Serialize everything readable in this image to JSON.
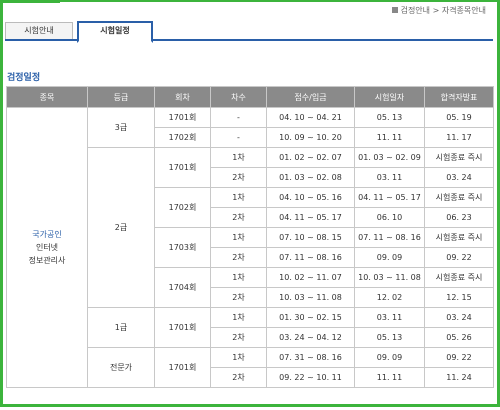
{
  "breadcrumb": [
    "검정안내",
    "자격종목안내"
  ],
  "tabs": [
    "시험안내",
    "시험일정"
  ],
  "section_title": "검정일정",
  "columns": [
    "종목",
    "등급",
    "회차",
    "차수",
    "접수/입금",
    "시험일자",
    "합격자발표"
  ],
  "kind": [
    "국가공인",
    "인터넷",
    "정보관리사"
  ],
  "rows": [
    {
      "grade": "3급",
      "session": "1701회",
      "cha": "-",
      "apply": "04. 10 ~ 04. 21",
      "exam": "05. 13",
      "result": "05. 19"
    },
    {
      "session": "1702회",
      "cha": "-",
      "apply": "10. 09 ~ 10. 20",
      "exam": "11. 11",
      "result": "11. 17"
    },
    {
      "grade": "2급",
      "session": "1701회",
      "cha": "1차",
      "apply": "01. 02 ~ 02. 07",
      "exam": "01. 03 ~ 02. 09",
      "result": "시험종료 즉시"
    },
    {
      "cha": "2차",
      "apply": "01. 03 ~ 02. 08",
      "exam": "03. 11",
      "result": "03. 24"
    },
    {
      "session": "1702회",
      "cha": "1차",
      "apply": "04. 10 ~ 05. 16",
      "exam": "04. 11 ~ 05. 17",
      "result": "시험종료 즉시"
    },
    {
      "cha": "2차",
      "apply": "04. 11 ~ 05. 17",
      "exam": "06. 10",
      "result": "06. 23"
    },
    {
      "session": "1703회",
      "cha": "1차",
      "apply": "07. 10 ~ 08. 15",
      "exam": "07. 11 ~ 08. 16",
      "result": "시험종료 즉시"
    },
    {
      "cha": "2차",
      "apply": "07. 11 ~ 08. 16",
      "exam": "09. 09",
      "result": "09. 22"
    },
    {
      "session": "1704회",
      "cha": "1차",
      "apply": "10. 02 ~ 11. 07",
      "exam": "10. 03 ~ 11. 08",
      "result": "시험종료 즉시"
    },
    {
      "cha": "2차",
      "apply": "10. 03 ~ 11. 08",
      "exam": "12. 02",
      "result": "12. 15"
    },
    {
      "grade": "1급",
      "session": "1701회",
      "cha": "1차",
      "apply": "01. 30 ~ 02. 15",
      "exam": "03. 11",
      "result": "03. 24"
    },
    {
      "cha": "2차",
      "apply": "03. 24 ~ 04. 12",
      "exam": "05. 13",
      "result": "05. 26"
    },
    {
      "grade": "전문가",
      "session": "1701회",
      "cha": "1차",
      "apply": "07. 31 ~ 08. 16",
      "exam": "09. 09",
      "result": "09. 22"
    },
    {
      "cha": "2차",
      "apply": "09. 22 ~ 10. 11",
      "exam": "11. 11",
      "result": "11. 24"
    }
  ]
}
